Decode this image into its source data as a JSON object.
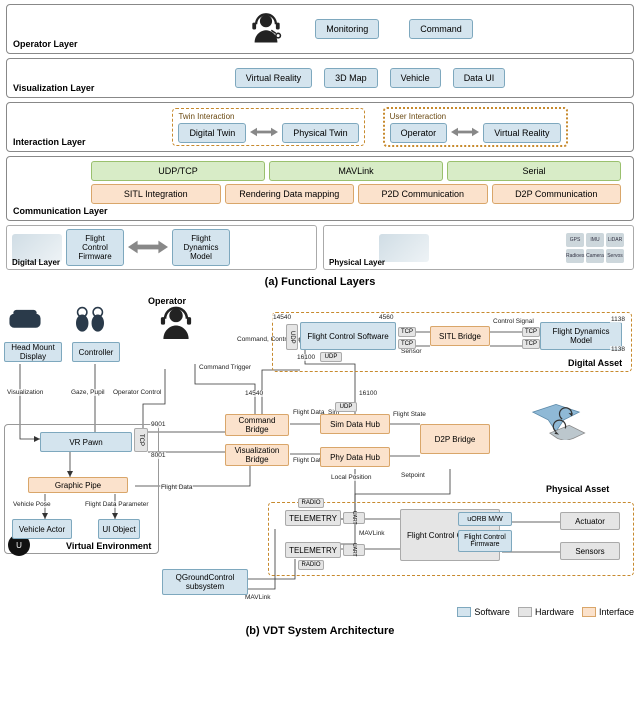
{
  "captionA": "(a) Functional Layers",
  "captionB": "(b) VDT System Architecture",
  "layers": {
    "operator": {
      "name": "Operator Layer",
      "boxes": [
        "Monitoring",
        "Command"
      ]
    },
    "visualization": {
      "name": "Visualization Layer",
      "boxes": [
        "Virtual Reality",
        "3D Map",
        "Vehicle",
        "Data UI"
      ]
    },
    "interaction": {
      "name": "Interaction Layer",
      "twin": {
        "title": "Twin Interaction",
        "left": "Digital Twin",
        "right": "Physical Twin"
      },
      "user": {
        "title": "User Interaction",
        "left": "Operator",
        "right": "Virtual Reality"
      }
    },
    "communication": {
      "name": "Communication Layer",
      "row1": [
        "UDP/TCP",
        "MAVLink",
        "Serial"
      ],
      "row2": [
        "SITL Integration",
        "Rendering Data mapping",
        "P2D Communication",
        "D2P Communication"
      ]
    },
    "digital": {
      "name": "Digital Layer",
      "fcf": "Flight Control Firmware",
      "fdm": "Flight Dynamics Model"
    },
    "physical": {
      "name": "Physical Layer",
      "sensors": [
        "GPS",
        "IMU",
        "LiDAR",
        "Radioes",
        "Camera",
        "Servos"
      ]
    }
  },
  "partB": {
    "operator": "Operator",
    "hmd": "Head Mount Display",
    "controller": "Controller",
    "vrpawn": "VR Pawn",
    "gp": "Graphic Pipe",
    "va": "Vehicle Actor",
    "ui": "UI Object",
    "ve": "Virtual Environment",
    "qgc": "QGroundControl subsystem",
    "cmdBridge": "Command Bridge",
    "visBridge": "Visualization Bridge",
    "simHub": "Sim Data Hub",
    "phyHub": "Phy Data Hub",
    "d2p": "D2P Bridge",
    "fcs": "Flight Control Software",
    "sitl": "SITL Bridge",
    "fdm": "Flight Dynamics Model",
    "da": "Digital Asset",
    "telemetry": "TELEMETRY",
    "fcc": "Flight Control Computer",
    "uorb": "uORB M/W",
    "fcfB": "Flight Control Firmware",
    "actuator": "Actuator",
    "sensors": "Sensors",
    "pa": "Physical Asset",
    "ports": {
      "p14540": "14540",
      "p4560": "4560",
      "p1138": "1138",
      "p16100": "16100",
      "p9001": "9001",
      "p8001": "8001",
      "udp": "UDP",
      "tcp": "TCP",
      "radio": "RADIO",
      "uart": "UART"
    },
    "labels": {
      "viz": "Visualization",
      "gaze": "Gaze, Pupil",
      "opctrl": "Operator Control",
      "cmdci": "Command, Control Input",
      "cmdtrigger": "Command Trigger",
      "fd": "Flight Data",
      "fdsim": "Flight Data_Sim",
      "fdphy": "Flight Data_Phy",
      "vp": "Vehicle Pose",
      "fdparam": "Flight Data Parameter",
      "fstate": "Flight State",
      "lp": "Local Position",
      "sp": "Setpoint",
      "mavlink": "MAVLink",
      "sensor": "Sensor",
      "ctrlsig": "Control Signal"
    },
    "legend": {
      "sw": "Software",
      "hw": "Hardware",
      "if": "Interface"
    }
  }
}
